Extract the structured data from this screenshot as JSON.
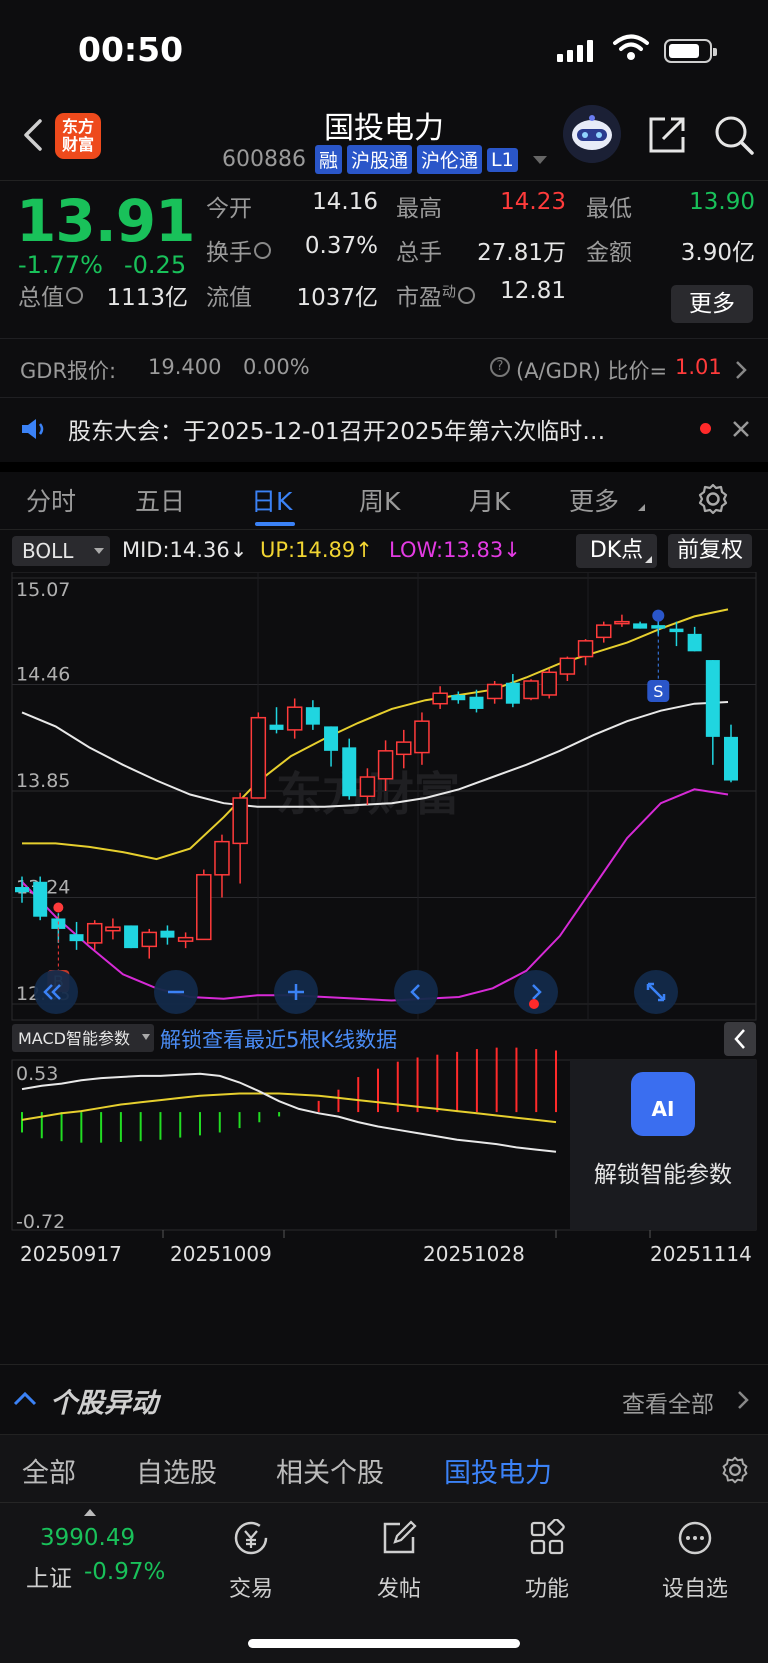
{
  "status": {
    "time": "00:50"
  },
  "header": {
    "logo_line1": "东方",
    "logo_line2": "财富",
    "title": "国投电力",
    "code": "600886",
    "tags": [
      "融",
      "沪股通",
      "沪伦通",
      "L1"
    ]
  },
  "quote": {
    "price": "13.91",
    "change_pct": "-1.77%",
    "change_amt": "-0.25",
    "fields": [
      {
        "label": "今开",
        "value": "14.16"
      },
      {
        "label": "最高",
        "value": "14.23"
      },
      {
        "label": "最低",
        "value": "13.90"
      },
      {
        "label": "换手",
        "value": "0.37%"
      },
      {
        "label": "总手",
        "value": "27.81万"
      },
      {
        "label": "金额",
        "value": "3.90亿"
      },
      {
        "label": "总值",
        "value": "1113亿"
      },
      {
        "label": "流值",
        "value": "1037亿"
      },
      {
        "label": "市盈",
        "value": "12.81"
      }
    ],
    "pe_sup": "动",
    "more_label": "更多"
  },
  "gdr": {
    "label": "GDR报价:",
    "price": "19.400",
    "pct": "0.00%",
    "ratio_label": "(A/GDR) 比价=",
    "ratio": "1.01"
  },
  "notice": {
    "text": "股东大会：于2025-12-01召开2025年第六次临时…"
  },
  "tabs": [
    "分时",
    "五日",
    "日K",
    "周K",
    "月K",
    "更多"
  ],
  "active_tab": "日K",
  "boll": {
    "indicator": "BOLL",
    "mid": "MID:14.36",
    "up": "UP:14.89",
    "low": "LOW:13.83",
    "mid_arrow": "↓",
    "up_arrow": "↑",
    "low_arrow": "↓",
    "dk_label": "DK点",
    "fq_label": "前复权"
  },
  "chart_data": {
    "type": "candlestick",
    "y_labels": [
      "15.07",
      "14.46",
      "13.85",
      "13.24",
      "12.63"
    ],
    "ylim": [
      12.63,
      15.07
    ],
    "watermark": "东方财富",
    "x_labels": [
      "20250917",
      "20251009",
      "20251028",
      "20251114"
    ],
    "markers": {
      "buy": "B",
      "sell": "S"
    },
    "candles": [
      [
        13.3,
        13.36,
        13.21,
        13.27
      ],
      [
        13.33,
        13.36,
        13.11,
        13.13
      ],
      [
        13.12,
        13.15,
        12.98,
        13.06
      ],
      [
        13.03,
        13.1,
        12.94,
        12.99
      ],
      [
        12.98,
        13.11,
        12.94,
        13.09
      ],
      [
        13.05,
        13.12,
        13.0,
        13.07
      ],
      [
        13.08,
        13.08,
        12.95,
        12.95
      ],
      [
        12.96,
        13.06,
        12.89,
        13.04
      ],
      [
        13.05,
        13.08,
        12.97,
        13.01
      ],
      [
        12.99,
        13.04,
        12.95,
        13.01
      ],
      [
        13.0,
        13.4,
        13.0,
        13.37
      ],
      [
        13.37,
        13.6,
        13.24,
        13.56
      ],
      [
        13.55,
        13.84,
        13.32,
        13.81
      ],
      [
        13.81,
        14.3,
        13.81,
        14.27
      ],
      [
        14.23,
        14.33,
        14.18,
        14.2
      ],
      [
        14.2,
        14.38,
        14.15,
        14.33
      ],
      [
        14.33,
        14.37,
        14.2,
        14.23
      ],
      [
        14.22,
        14.22,
        13.99,
        14.08
      ],
      [
        14.1,
        14.15,
        13.8,
        13.82
      ],
      [
        13.82,
        13.98,
        13.77,
        13.93
      ],
      [
        13.92,
        14.14,
        13.85,
        14.08
      ],
      [
        14.06,
        14.2,
        13.98,
        14.13
      ],
      [
        14.07,
        14.3,
        14.0,
        14.25
      ],
      [
        14.35,
        14.45,
        14.32,
        14.41
      ],
      [
        14.4,
        14.42,
        14.35,
        14.37
      ],
      [
        14.39,
        14.43,
        14.3,
        14.32
      ],
      [
        14.38,
        14.48,
        14.35,
        14.46
      ],
      [
        14.47,
        14.52,
        14.33,
        14.35
      ],
      [
        14.38,
        14.49,
        14.37,
        14.48
      ],
      [
        14.4,
        14.55,
        14.38,
        14.53
      ],
      [
        14.52,
        14.62,
        14.48,
        14.61
      ],
      [
        14.62,
        14.72,
        14.57,
        14.71
      ],
      [
        14.73,
        14.82,
        14.7,
        14.8
      ],
      [
        14.81,
        14.86,
        14.79,
        14.82
      ],
      [
        14.81,
        14.82,
        14.78,
        14.78
      ],
      [
        14.8,
        14.84,
        14.74,
        14.78
      ],
      [
        14.78,
        14.82,
        14.68,
        14.76
      ],
      [
        14.75,
        14.79,
        14.65,
        14.65
      ],
      [
        14.6,
        14.6,
        14.0,
        14.16
      ],
      [
        14.16,
        14.23,
        13.9,
        13.91
      ]
    ],
    "boll_up": [
      13.55,
      13.55,
      13.53,
      13.5,
      13.46,
      13.52,
      13.7,
      13.9,
      14.05,
      14.15,
      14.24,
      14.32,
      14.37,
      14.4,
      14.43,
      14.5,
      14.58,
      14.64,
      14.7,
      14.78,
      14.85,
      14.89
    ],
    "boll_mid": [
      14.3,
      14.22,
      14.1,
      14.0,
      13.91,
      13.83,
      13.78,
      13.76,
      13.76,
      13.76,
      13.77,
      13.78,
      13.81,
      13.86,
      13.93,
      14.0,
      14.08,
      14.17,
      14.25,
      14.31,
      14.35,
      14.36
    ],
    "boll_low": [
      13.33,
      13.13,
      12.96,
      12.8,
      12.72,
      12.67,
      12.66,
      12.68,
      12.68,
      12.67,
      12.66,
      12.65,
      12.66,
      12.67,
      12.72,
      12.82,
      13.02,
      13.3,
      13.58,
      13.78,
      13.86,
      13.83
    ],
    "macd": {
      "indicator": "MACD智能参数",
      "unlock_text": "解锁查看最近5根K线数据",
      "y_labels": [
        "0.53",
        "-0.72"
      ],
      "ylim": [
        -0.72,
        0.53
      ],
      "hist": [
        -0.28,
        -0.36,
        -0.4,
        -0.42,
        -0.42,
        -0.41,
        -0.4,
        -0.38,
        -0.35,
        -0.32,
        -0.28,
        -0.22,
        -0.14,
        -0.06,
        0.0,
        0.08,
        0.16,
        0.25,
        0.31,
        0.36,
        0.39,
        0.41,
        0.43,
        0.45,
        0.46,
        0.46,
        0.45,
        0.44
      ],
      "dif": [
        -0.58,
        -0.61,
        -0.63,
        -0.66,
        -0.68,
        -0.69,
        -0.7,
        -0.7,
        -0.71,
        -0.72,
        -0.7,
        -0.64,
        -0.56,
        -0.47,
        -0.4,
        -0.36,
        -0.33,
        -0.28,
        -0.24,
        -0.21,
        -0.18,
        -0.15,
        -0.12,
        -0.1,
        -0.08,
        -0.05,
        -0.03,
        -0.01
      ],
      "dea": [
        -0.3,
        -0.33,
        -0.36,
        -0.38,
        -0.41,
        -0.44,
        -0.46,
        -0.48,
        -0.5,
        -0.52,
        -0.53,
        -0.54,
        -0.54,
        -0.54,
        -0.53,
        -0.52,
        -0.5,
        -0.48,
        -0.46,
        -0.44,
        -0.42,
        -0.4,
        -0.38,
        -0.36,
        -0.34,
        -0.32,
        -0.3,
        -0.28
      ],
      "overlay_label": "解锁智能参数",
      "overlay_icon_text": "AI"
    }
  },
  "movers": {
    "title": "个股异动",
    "view_all": "查看全部"
  },
  "subtabs": [
    "全部",
    "自选股",
    "相关个股",
    "国投电力"
  ],
  "active_subtab": "国投电力",
  "bottom": {
    "index_value": "3990.49",
    "index_name": "上证",
    "index_pct": "-0.97%",
    "nav": [
      "交易",
      "发帖",
      "功能",
      "设自选"
    ]
  }
}
